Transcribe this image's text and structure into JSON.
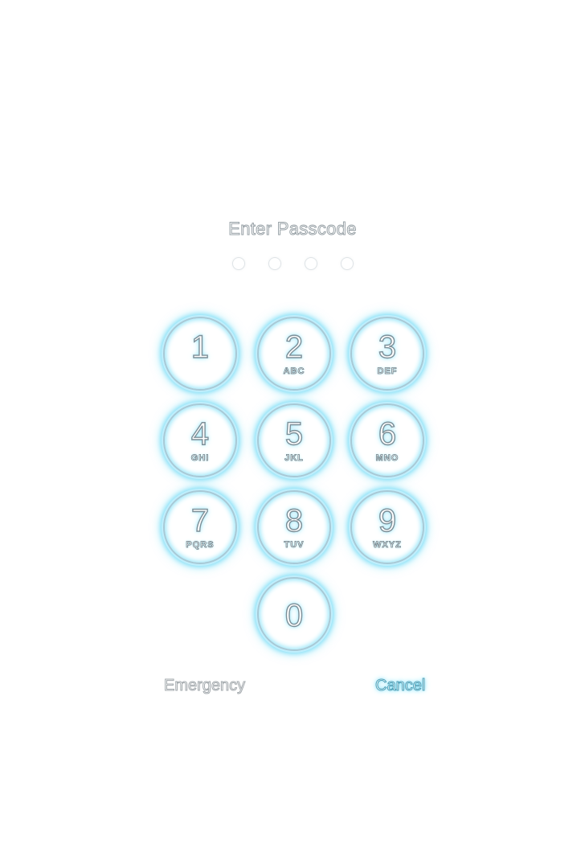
{
  "title": "Enter Passcode",
  "passcode_dots": [
    false,
    false,
    false,
    false
  ],
  "keys": [
    {
      "digit": "1",
      "letters": ""
    },
    {
      "digit": "2",
      "letters": "ABC"
    },
    {
      "digit": "3",
      "letters": "DEF"
    },
    {
      "digit": "4",
      "letters": "GHI"
    },
    {
      "digit": "5",
      "letters": "JKL"
    },
    {
      "digit": "6",
      "letters": "MNO"
    },
    {
      "digit": "7",
      "letters": "PQRS"
    },
    {
      "digit": "8",
      "letters": "TUV"
    },
    {
      "digit": "9",
      "letters": "WXYZ"
    },
    {
      "digit": "0",
      "letters": ""
    }
  ],
  "footer": {
    "emergency_label": "Emergency",
    "cancel_label": "Cancel"
  },
  "colors": {
    "background": "#ffffff",
    "key_glow": "#82dff7",
    "text_outline": "#9aa3a8"
  }
}
